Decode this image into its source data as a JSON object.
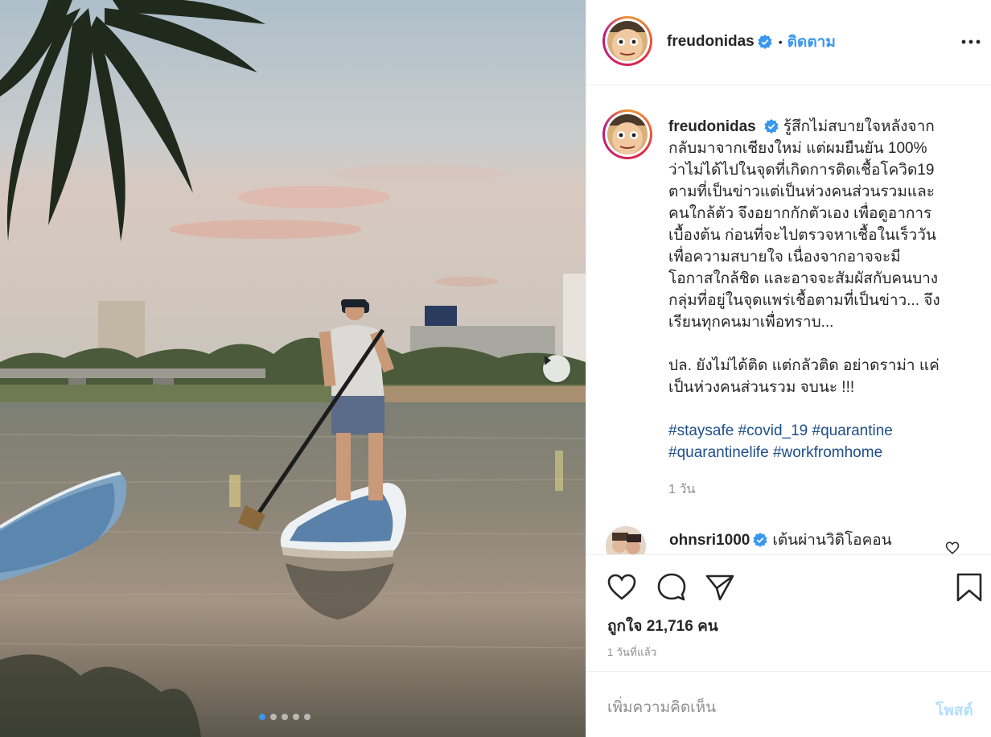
{
  "post": {
    "username": "freudonidas",
    "verified": true,
    "follow_label": "ติดตาม",
    "bullet": "•",
    "carousel": {
      "total": 5,
      "active_index": 0
    }
  },
  "caption": {
    "lines": [
      "รู้สึกไม่สบายใจหลังจาก",
      "กลับมาจากเชียงใหม่ แต่ผมยืนยัน 100%",
      "ว่าไม่ได้ไปในจุดที่เกิดการติดเชื้อโควิด19",
      "ตามที่เป็นข่าวแต่เป็นห่วงคนส่วนรวมและ",
      "คนใกล้ตัว จึงอยากกักตัวเอง เพื่อดูอาการ",
      "เบื้องต้น ก่อนที่จะไปตรวจหาเชื้อในเร็ววัน",
      "เพื่อความสบายใจ เนื่องจากอาจจะมี",
      "โอกาสใกล้ชิด และอาจจะสัมผัสกับคนบาง",
      "กลุ่มที่อยู่ในจุดแพร่เชื้อตามที่เป็นข่าว... จึง",
      "เรียนทุกคนมาเพื่อทราบ..."
    ],
    "ps_lines": [
      "ปล. ยังไม่ได้ติด แต่กลัวติด อย่าดราม่า แค่",
      "เป็นห่วงคนส่วนรวม จบนะ !!!"
    ],
    "hashtags_line1": [
      "#staysafe",
      "#covid_19",
      "#quarantine"
    ],
    "hashtags_line2": [
      "#quarantinelife",
      "#workfromhome"
    ],
    "age": "1 วัน"
  },
  "comment": {
    "username": "ohnsri1000",
    "verified": true,
    "text": "เต้นผ่านวิดิโอคอน"
  },
  "stats": {
    "likes_label": "ถูกใจ 21,716 คน",
    "posted": "1 วันที่แล้ว"
  },
  "add_comment": {
    "placeholder": "เพิ่มความคิดเห็น",
    "post_label": "โพสต์"
  },
  "colors": {
    "link_blue": "#3897f0",
    "hashtag": "#1d4f8a",
    "muted": "#8e8e8e",
    "post_disabled": "#b2dffc",
    "verified": "#3897f0"
  }
}
